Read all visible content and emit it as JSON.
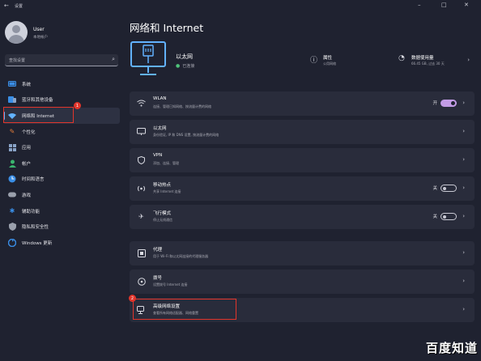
{
  "window": {
    "title": "设置",
    "back_icon": "back-arrow-icon",
    "controls": [
      "minimize-icon",
      "maximize-icon",
      "close-icon"
    ]
  },
  "user": {
    "name": "User",
    "account": "本地帐户"
  },
  "search": {
    "placeholder": "查找设置"
  },
  "nav": [
    {
      "label": "系统",
      "icon": "system-icon",
      "color": "#3a8ee6"
    },
    {
      "label": "蓝牙和其他设备",
      "icon": "bluetooth-icon",
      "color": "#3a8ee6"
    },
    {
      "label": "网络和 Internet",
      "icon": "network-icon",
      "color": "#62b2ff",
      "active": true
    },
    {
      "label": "个性化",
      "icon": "personalization-icon",
      "color": "#e07b39"
    },
    {
      "label": "应用",
      "icon": "apps-icon",
      "color": "#8aa4c8"
    },
    {
      "label": "帐户",
      "icon": "accounts-icon",
      "color": "#3ab56e"
    },
    {
      "label": "时间和语言",
      "icon": "time-language-icon",
      "color": "#3a8ee6"
    },
    {
      "label": "游戏",
      "icon": "gaming-icon",
      "color": "#9aa0ac"
    },
    {
      "label": "辅助功能",
      "icon": "accessibility-icon",
      "color": "#3a8ee6"
    },
    {
      "label": "隐私和安全性",
      "icon": "privacy-icon",
      "color": "#9aa0ac"
    },
    {
      "label": "Windows 更新",
      "icon": "windows-update-icon",
      "color": "#3a8ee6"
    }
  ],
  "page": {
    "title": "网络和 Internet"
  },
  "hero": {
    "connection": "以太网",
    "status": "已连接",
    "props": [
      {
        "title": "属性",
        "sub": "公用网络",
        "icon": "info-icon"
      },
      {
        "title": "数据使用量",
        "sub": "66.45 GB, 过去 30 天",
        "icon": "data-usage-icon"
      }
    ]
  },
  "cards": [
    {
      "title": "WLAN",
      "sub": "连接、管理已知网络、按流量计费的网络",
      "icon": "wifi-icon",
      "toggle": true,
      "toggle_label": "开"
    },
    {
      "title": "以太网",
      "sub": "身份验证, IP 和 DNS 设置, 按流量计费的网络",
      "icon": "ethernet-icon"
    },
    {
      "title": "VPN",
      "sub": "添加、连接、管理",
      "icon": "vpn-shield-icon"
    },
    {
      "title": "移动热点",
      "sub": "共享 Internet 连接",
      "icon": "hotspot-icon",
      "toggle": false,
      "toggle_label": "关"
    },
    {
      "title": "飞行模式",
      "sub": "停止无线通信",
      "icon": "airplane-icon",
      "toggle": false,
      "toggle_label": "关"
    },
    {
      "title": "代理",
      "sub": "用于 Wi-Fi 和以太网连接的代理服务器",
      "icon": "proxy-icon"
    },
    {
      "title": "拨号",
      "sub": "设置拨号 Internet 连接",
      "icon": "dialup-icon"
    },
    {
      "title": "高级网络设置",
      "sub": "查看所有网络适配器、网络重置",
      "icon": "advanced-network-icon"
    }
  ],
  "annotations": {
    "badge1": "1",
    "badge2": "2"
  },
  "watermark": "百度知道",
  "colors": {
    "accent": "#62b2ff",
    "highlight_red": "#e2352b",
    "toggle_on": "#c39ce6",
    "connected": "#4fc37a"
  }
}
